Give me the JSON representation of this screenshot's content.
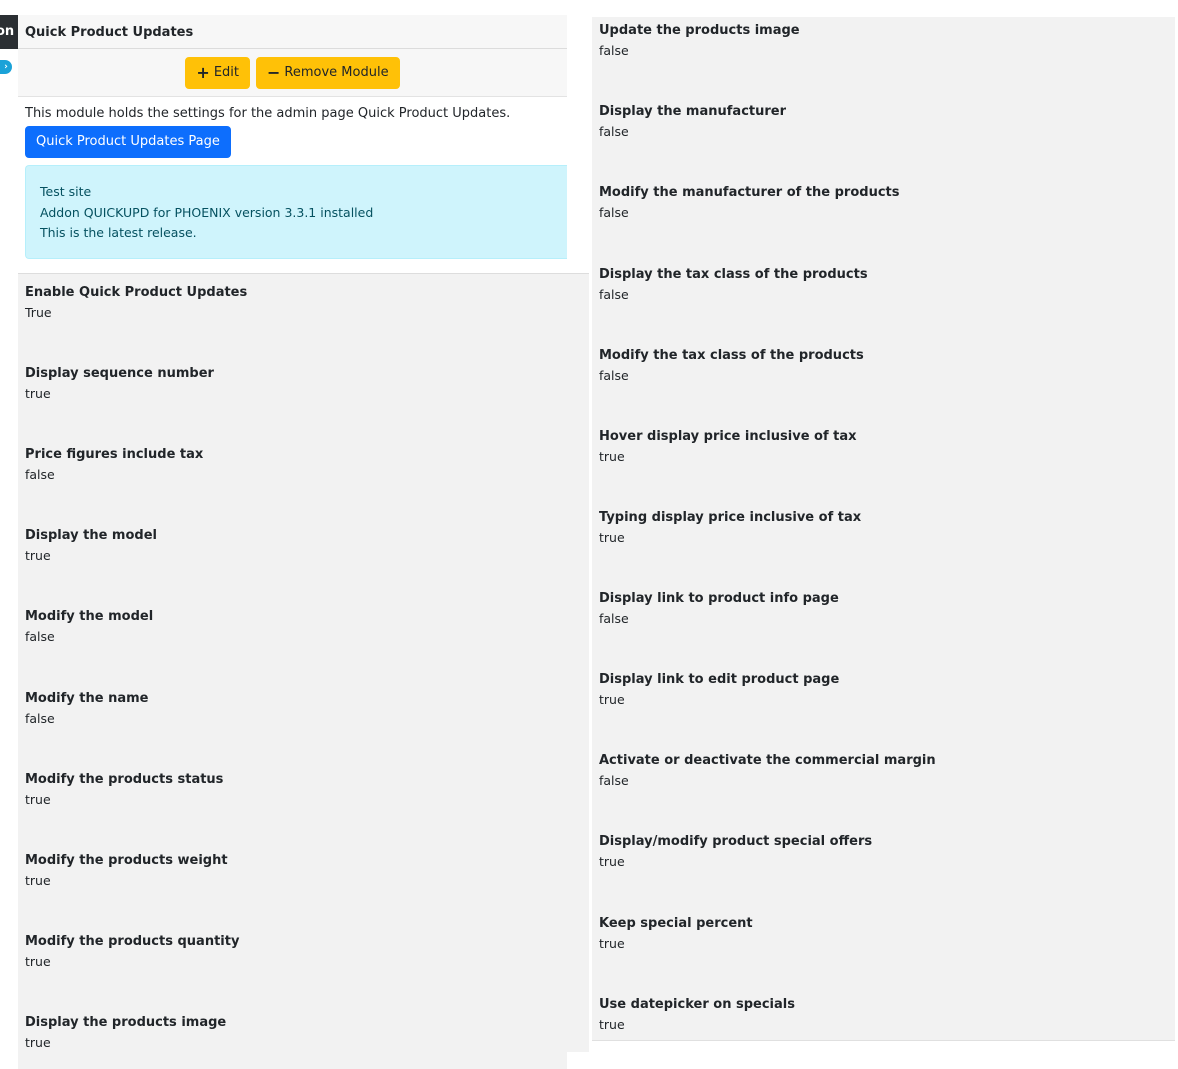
{
  "edge": {
    "tab_text": "on"
  },
  "module": {
    "title": "Quick Product Updates",
    "edit_label": "Edit",
    "remove_label": "Remove Module",
    "description": "This module holds the settings for the admin page Quick Product Updates.",
    "page_button_label": "Quick Product Updates Page",
    "info": {
      "line1": "Test site",
      "line2": "Addon QUICKUPD for PHOENIX version 3.3.1 installed",
      "line3": "This is the latest release."
    }
  },
  "settings_left": [
    {
      "title": "Enable Quick Product Updates",
      "value": "True"
    },
    {
      "title": "Display sequence number",
      "value": "true"
    },
    {
      "title": "Price figures include tax",
      "value": "false"
    },
    {
      "title": "Display the model",
      "value": "true"
    },
    {
      "title": "Modify the model",
      "value": "false"
    },
    {
      "title": "Modify the name",
      "value": "false"
    },
    {
      "title": "Modify the products status",
      "value": "true"
    },
    {
      "title": "Modify the products weight",
      "value": "true"
    },
    {
      "title": "Modify the products quantity",
      "value": "true"
    },
    {
      "title": "Display the products image",
      "value": "true"
    }
  ],
  "settings_right": [
    {
      "title": "Update the products image",
      "value": "false"
    },
    {
      "title": "Display the manufacturer",
      "value": "false"
    },
    {
      "title": "Modify the manufacturer of the products",
      "value": "false"
    },
    {
      "title": "Display the tax class of the products",
      "value": "false"
    },
    {
      "title": "Modify the tax class of the products",
      "value": "false"
    },
    {
      "title": "Hover display price inclusive of tax",
      "value": "true"
    },
    {
      "title": "Typing display price inclusive of tax",
      "value": "true"
    },
    {
      "title": "Display link to product info page",
      "value": "false"
    },
    {
      "title": "Display link to edit product page",
      "value": "true"
    },
    {
      "title": "Activate or deactivate the commercial margin",
      "value": "false"
    },
    {
      "title": "Display/modify product special offers",
      "value": "true"
    },
    {
      "title": "Keep special percent",
      "value": "true"
    },
    {
      "title": "Use datepicker on specials",
      "value": "true"
    }
  ],
  "colors": {
    "warning": "#ffc107",
    "primary": "#0d6efd",
    "info_bg": "#cff4fc",
    "info_text": "#055160",
    "panel_bg": "#f2f2f2"
  },
  "icons": {
    "edit": "plus-icon",
    "remove": "minus-icon",
    "edge": "chevron-right-icon"
  }
}
